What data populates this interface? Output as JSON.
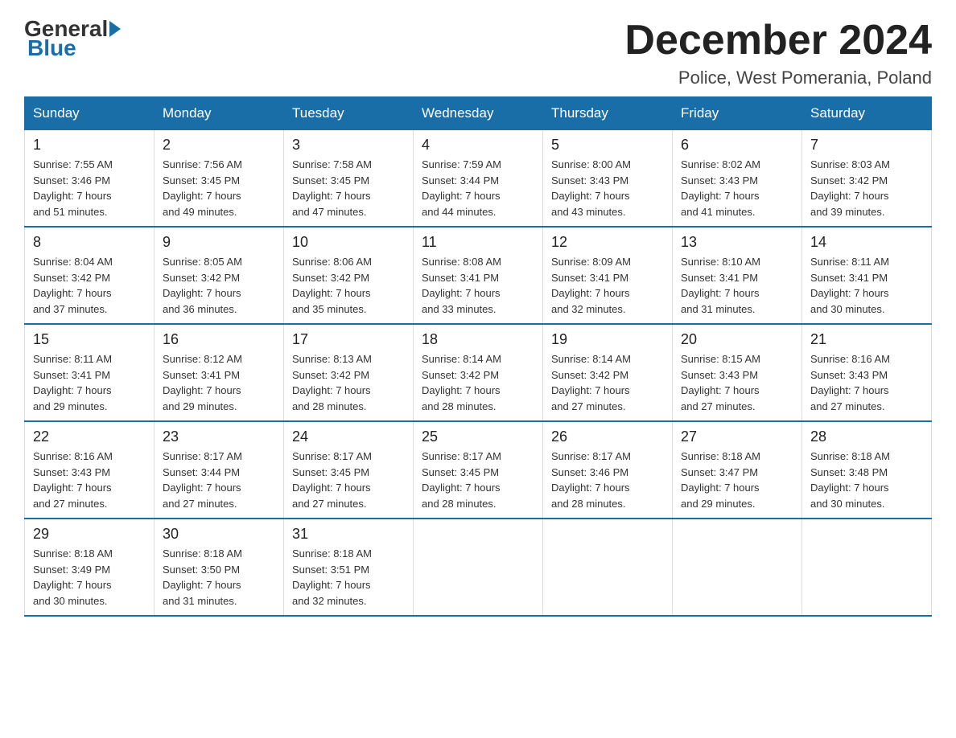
{
  "header": {
    "logo": {
      "general": "General",
      "blue": "Blue"
    },
    "title": "December 2024",
    "location": "Police, West Pomerania, Poland"
  },
  "days_of_week": [
    "Sunday",
    "Monday",
    "Tuesday",
    "Wednesday",
    "Thursday",
    "Friday",
    "Saturday"
  ],
  "weeks": [
    [
      {
        "day": "1",
        "info": "Sunrise: 7:55 AM\nSunset: 3:46 PM\nDaylight: 7 hours\nand 51 minutes."
      },
      {
        "day": "2",
        "info": "Sunrise: 7:56 AM\nSunset: 3:45 PM\nDaylight: 7 hours\nand 49 minutes."
      },
      {
        "day": "3",
        "info": "Sunrise: 7:58 AM\nSunset: 3:45 PM\nDaylight: 7 hours\nand 47 minutes."
      },
      {
        "day": "4",
        "info": "Sunrise: 7:59 AM\nSunset: 3:44 PM\nDaylight: 7 hours\nand 44 minutes."
      },
      {
        "day": "5",
        "info": "Sunrise: 8:00 AM\nSunset: 3:43 PM\nDaylight: 7 hours\nand 43 minutes."
      },
      {
        "day": "6",
        "info": "Sunrise: 8:02 AM\nSunset: 3:43 PM\nDaylight: 7 hours\nand 41 minutes."
      },
      {
        "day": "7",
        "info": "Sunrise: 8:03 AM\nSunset: 3:42 PM\nDaylight: 7 hours\nand 39 minutes."
      }
    ],
    [
      {
        "day": "8",
        "info": "Sunrise: 8:04 AM\nSunset: 3:42 PM\nDaylight: 7 hours\nand 37 minutes."
      },
      {
        "day": "9",
        "info": "Sunrise: 8:05 AM\nSunset: 3:42 PM\nDaylight: 7 hours\nand 36 minutes."
      },
      {
        "day": "10",
        "info": "Sunrise: 8:06 AM\nSunset: 3:42 PM\nDaylight: 7 hours\nand 35 minutes."
      },
      {
        "day": "11",
        "info": "Sunrise: 8:08 AM\nSunset: 3:41 PM\nDaylight: 7 hours\nand 33 minutes."
      },
      {
        "day": "12",
        "info": "Sunrise: 8:09 AM\nSunset: 3:41 PM\nDaylight: 7 hours\nand 32 minutes."
      },
      {
        "day": "13",
        "info": "Sunrise: 8:10 AM\nSunset: 3:41 PM\nDaylight: 7 hours\nand 31 minutes."
      },
      {
        "day": "14",
        "info": "Sunrise: 8:11 AM\nSunset: 3:41 PM\nDaylight: 7 hours\nand 30 minutes."
      }
    ],
    [
      {
        "day": "15",
        "info": "Sunrise: 8:11 AM\nSunset: 3:41 PM\nDaylight: 7 hours\nand 29 minutes."
      },
      {
        "day": "16",
        "info": "Sunrise: 8:12 AM\nSunset: 3:41 PM\nDaylight: 7 hours\nand 29 minutes."
      },
      {
        "day": "17",
        "info": "Sunrise: 8:13 AM\nSunset: 3:42 PM\nDaylight: 7 hours\nand 28 minutes."
      },
      {
        "day": "18",
        "info": "Sunrise: 8:14 AM\nSunset: 3:42 PM\nDaylight: 7 hours\nand 28 minutes."
      },
      {
        "day": "19",
        "info": "Sunrise: 8:14 AM\nSunset: 3:42 PM\nDaylight: 7 hours\nand 27 minutes."
      },
      {
        "day": "20",
        "info": "Sunrise: 8:15 AM\nSunset: 3:43 PM\nDaylight: 7 hours\nand 27 minutes."
      },
      {
        "day": "21",
        "info": "Sunrise: 8:16 AM\nSunset: 3:43 PM\nDaylight: 7 hours\nand 27 minutes."
      }
    ],
    [
      {
        "day": "22",
        "info": "Sunrise: 8:16 AM\nSunset: 3:43 PM\nDaylight: 7 hours\nand 27 minutes."
      },
      {
        "day": "23",
        "info": "Sunrise: 8:17 AM\nSunset: 3:44 PM\nDaylight: 7 hours\nand 27 minutes."
      },
      {
        "day": "24",
        "info": "Sunrise: 8:17 AM\nSunset: 3:45 PM\nDaylight: 7 hours\nand 27 minutes."
      },
      {
        "day": "25",
        "info": "Sunrise: 8:17 AM\nSunset: 3:45 PM\nDaylight: 7 hours\nand 28 minutes."
      },
      {
        "day": "26",
        "info": "Sunrise: 8:17 AM\nSunset: 3:46 PM\nDaylight: 7 hours\nand 28 minutes."
      },
      {
        "day": "27",
        "info": "Sunrise: 8:18 AM\nSunset: 3:47 PM\nDaylight: 7 hours\nand 29 minutes."
      },
      {
        "day": "28",
        "info": "Sunrise: 8:18 AM\nSunset: 3:48 PM\nDaylight: 7 hours\nand 30 minutes."
      }
    ],
    [
      {
        "day": "29",
        "info": "Sunrise: 8:18 AM\nSunset: 3:49 PM\nDaylight: 7 hours\nand 30 minutes."
      },
      {
        "day": "30",
        "info": "Sunrise: 8:18 AM\nSunset: 3:50 PM\nDaylight: 7 hours\nand 31 minutes."
      },
      {
        "day": "31",
        "info": "Sunrise: 8:18 AM\nSunset: 3:51 PM\nDaylight: 7 hours\nand 32 minutes."
      },
      {
        "day": "",
        "info": ""
      },
      {
        "day": "",
        "info": ""
      },
      {
        "day": "",
        "info": ""
      },
      {
        "day": "",
        "info": ""
      }
    ]
  ]
}
